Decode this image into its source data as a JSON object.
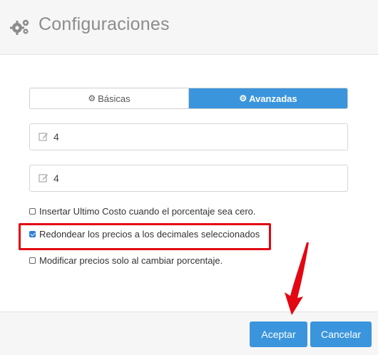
{
  "header": {
    "title": "Configuraciones",
    "icon": "gears-icon"
  },
  "tabs": [
    {
      "label": "Básicas",
      "icon": "gear-icon",
      "active": false
    },
    {
      "label": "Avanzadas",
      "icon": "gear-icon",
      "active": true
    }
  ],
  "fields": [
    {
      "value": "4",
      "icon": "edit-icon"
    },
    {
      "value": "4",
      "icon": "edit-icon"
    }
  ],
  "checkboxes": [
    {
      "label": "Insertar Ultimo Costo cuando el porcentaje sea cero.",
      "checked": false
    },
    {
      "label": "Redondear los precios a los decimales seleccionados",
      "checked": true
    },
    {
      "label": "Modificar precios solo al cambiar porcentaje.",
      "checked": false
    }
  ],
  "footer": {
    "accept_label": "Aceptar",
    "cancel_label": "Cancelar"
  },
  "colors": {
    "accent": "#3a95dc",
    "highlight": "#e30613"
  }
}
